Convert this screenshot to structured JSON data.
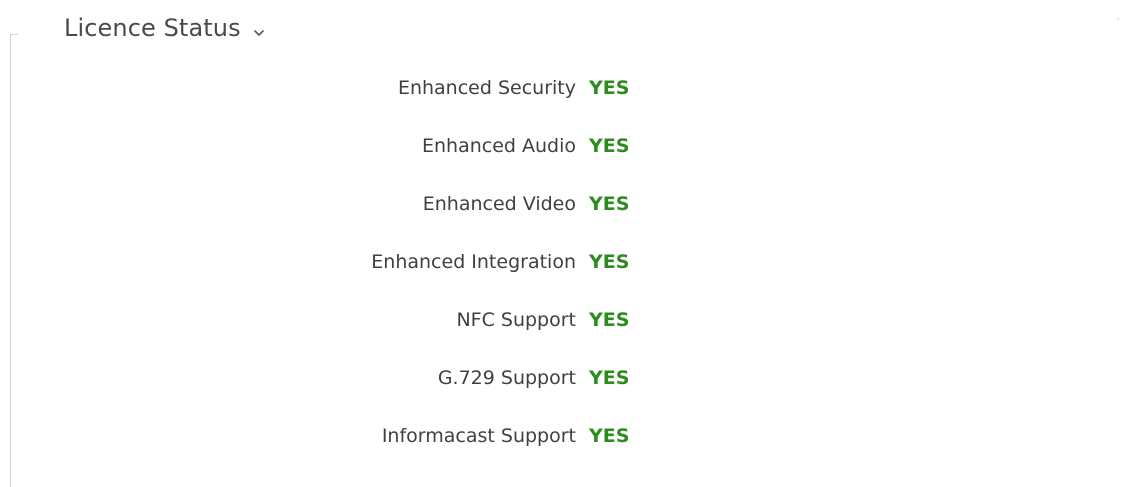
{
  "section": {
    "title": "Licence Status",
    "toggle_icon": "chevron-down-icon"
  },
  "colors": {
    "yes": "#2e8b1e",
    "label": "#404040",
    "title": "#4a4a4a"
  },
  "licences": [
    {
      "label": "Enhanced Security",
      "value": "YES"
    },
    {
      "label": "Enhanced Audio",
      "value": "YES"
    },
    {
      "label": "Enhanced Video",
      "value": "YES"
    },
    {
      "label": "Enhanced Integration",
      "value": "YES"
    },
    {
      "label": "NFC Support",
      "value": "YES"
    },
    {
      "label": "G.729 Support",
      "value": "YES"
    },
    {
      "label": "Informacast Support",
      "value": "YES"
    }
  ]
}
